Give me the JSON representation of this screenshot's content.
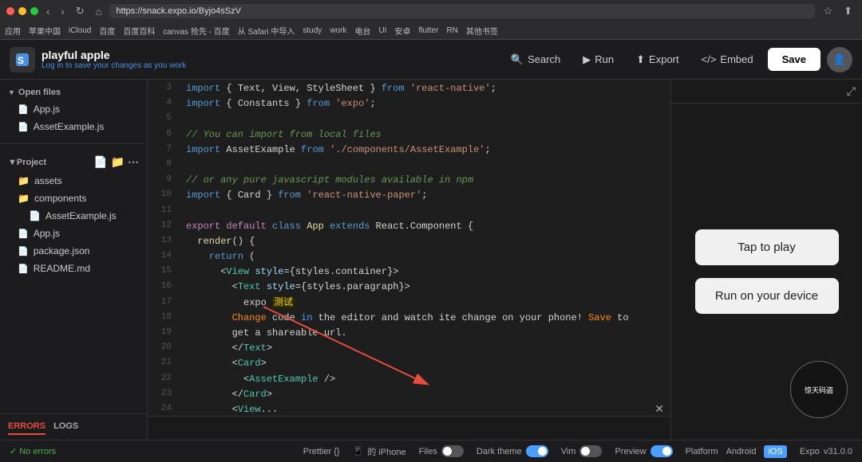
{
  "browser": {
    "url": "https://snack.expo.io/Byjo4sSzV",
    "bookmarks": [
      "应用",
      "苹果中国",
      "iCloud",
      "百度",
      "百度百科",
      "canvas 抢先 - 百度",
      "从 Safari 中导入",
      "study",
      "work",
      "电台",
      "UI",
      "安卓",
      "flutter",
      "RN",
      "其他书签"
    ]
  },
  "header": {
    "logo_title": "playful apple",
    "logo_subtitle": "Log in to save your changes as you work",
    "search_label": "Search",
    "run_label": "Run",
    "export_label": "Export",
    "embed_label": "Embed",
    "save_label": "Save"
  },
  "sidebar": {
    "open_files_label": "Open files",
    "file1": "App.js",
    "file2": "AssetExample.js",
    "project_label": "Project",
    "folder_assets": "assets",
    "folder_components": "components",
    "file_asset_example": "AssetExample.js",
    "file_app": "App.js",
    "file_package": "package.json",
    "file_readme": "README.md",
    "errors_label": "ERRORS",
    "logs_label": "LOGS",
    "no_errors": "No errors"
  },
  "code": {
    "lines": [
      {
        "num": 3,
        "text": "import { Text, View, StyleSheet } from 'react-native';"
      },
      {
        "num": 4,
        "text": "import { Constants } from 'expo';"
      },
      {
        "num": 5,
        "text": ""
      },
      {
        "num": 6,
        "text": "// You can import from local files"
      },
      {
        "num": 7,
        "text": "import AssetExample from './components/AssetExample';"
      },
      {
        "num": 8,
        "text": ""
      },
      {
        "num": 9,
        "text": "// or any pure javascript modules available in npm"
      },
      {
        "num": 10,
        "text": "import { Card } from 'react-native-paper';"
      },
      {
        "num": 11,
        "text": ""
      },
      {
        "num": 12,
        "text": "export default class App extends React.Component {"
      },
      {
        "num": 13,
        "text": "  render() {"
      },
      {
        "num": 14,
        "text": "    return ("
      },
      {
        "num": 15,
        "text": "      <View style={styles.container}>"
      },
      {
        "num": 16,
        "text": "        <Text style={styles.paragraph}>"
      },
      {
        "num": 17,
        "text": "          expo 测试"
      },
      {
        "num": 18,
        "text": "        Change code in the editor and watch ite change on your phone! Save to"
      },
      {
        "num": 19,
        "text": "        get a shareable url."
      },
      {
        "num": 20,
        "text": "        </Text>"
      },
      {
        "num": 21,
        "text": "        <Card>"
      },
      {
        "num": 22,
        "text": "          <AssetExample />"
      },
      {
        "num": 23,
        "text": "        </Card>"
      },
      {
        "num": 24,
        "text": "        <View..."
      }
    ]
  },
  "preview": {
    "tap_to_play": "Tap to play",
    "run_on_device": "Run on your device"
  },
  "bottom_bar": {
    "prettier_label": "Prettier {}",
    "device_label": "的 iPhone",
    "files_label": "Files",
    "dark_theme_label": "Dark theme",
    "vim_label": "Vim",
    "preview_label": "Preview",
    "platform_label": "Platform",
    "android_label": "Android",
    "ios_label": "iOS",
    "expo_label": "Expo",
    "version_label": "v31.0.0"
  }
}
